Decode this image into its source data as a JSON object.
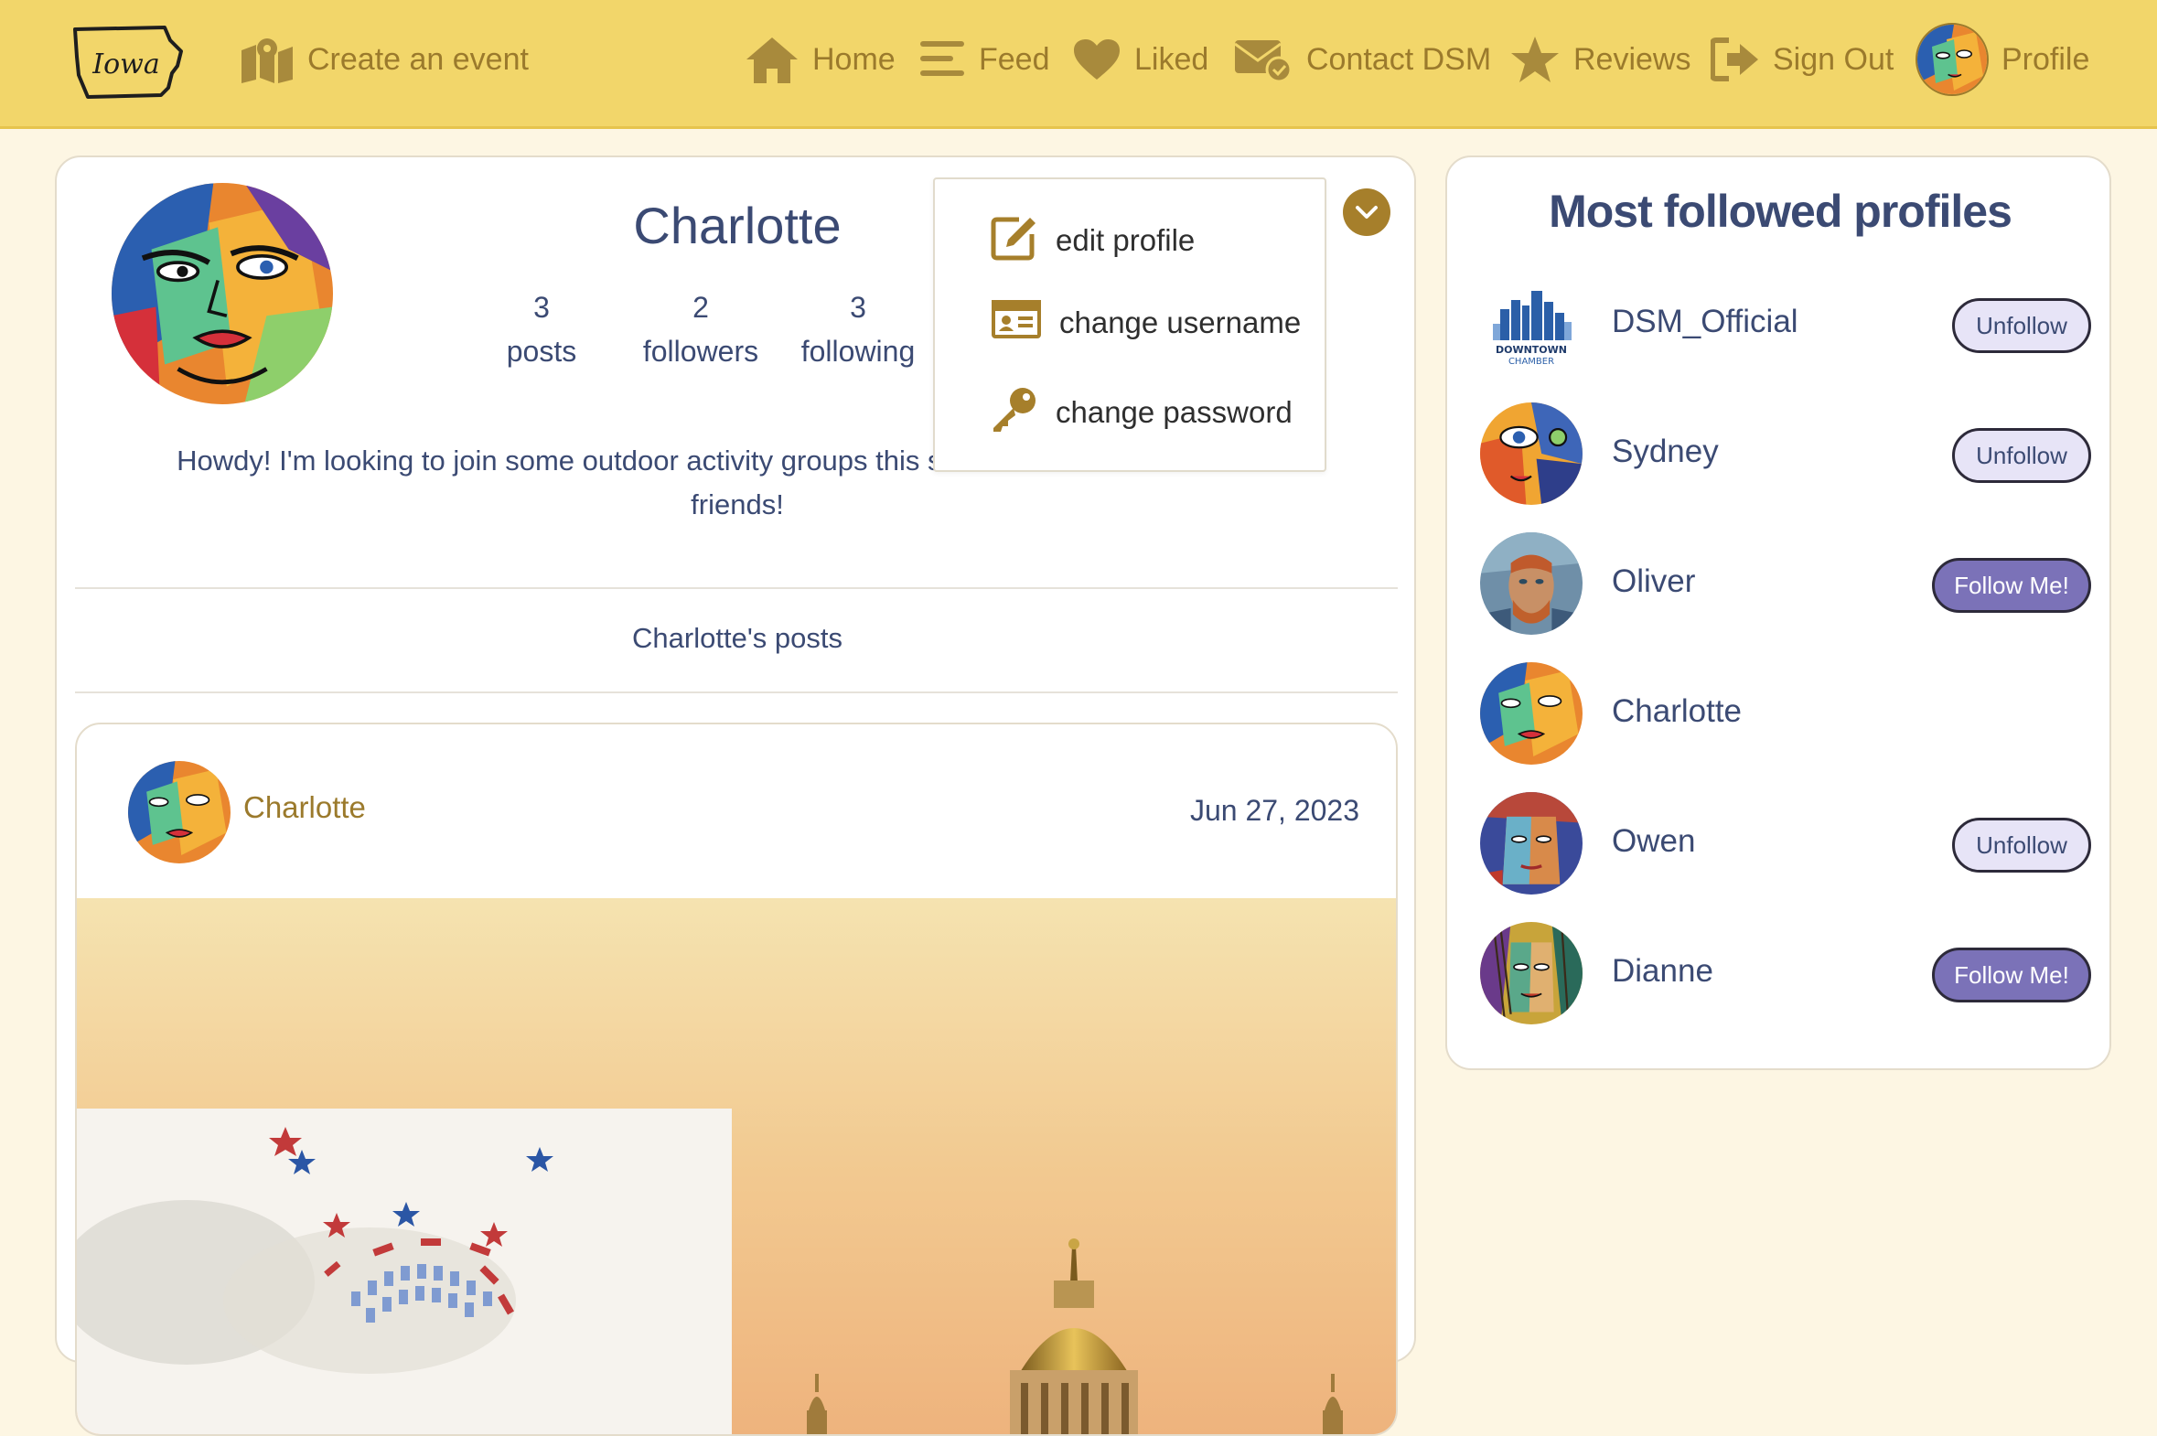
{
  "nav": {
    "logo_text": "Iowa",
    "create_event": "Create an event",
    "home": "Home",
    "feed": "Feed",
    "liked": "Liked",
    "contact": "Contact DSM",
    "reviews": "Reviews",
    "sign_out": "Sign Out",
    "profile": "Profile"
  },
  "profile": {
    "name": "Charlotte",
    "posts_count": "3",
    "posts_label": "posts",
    "followers_count": "2",
    "followers_label": "followers",
    "following_count": "3",
    "following_label": "following",
    "bio": "Howdy! I'm looking to join some outdoor activity groups this summer and make a few new friends!",
    "posts_heading": "Charlotte's posts"
  },
  "menu": {
    "edit_profile": "edit profile",
    "change_username": "change username",
    "change_password": "change password"
  },
  "post": {
    "author": "Charlotte",
    "date": "Jun 27, 2023"
  },
  "sidebar": {
    "title": "Most followed profiles",
    "dsm_logo_line1": "DOWNTOWN",
    "dsm_logo_line2": "CHAMBER",
    "profiles": [
      {
        "name": "DSM_Official",
        "button": "Unfollow"
      },
      {
        "name": "Sydney",
        "button": "Unfollow"
      },
      {
        "name": "Oliver",
        "button": "Follow Me!"
      },
      {
        "name": "Charlotte",
        "button": ""
      },
      {
        "name": "Owen",
        "button": "Unfollow"
      },
      {
        "name": "Dianne",
        "button": "Follow Me!"
      }
    ]
  },
  "colors": {
    "navbar": "#f2d66a",
    "nav_text": "#9b7a2c",
    "heading": "#3b4a73",
    "follow_button": "#7b72b8",
    "unfollow_button": "#e7e4f7",
    "background": "#fdf6e3"
  }
}
